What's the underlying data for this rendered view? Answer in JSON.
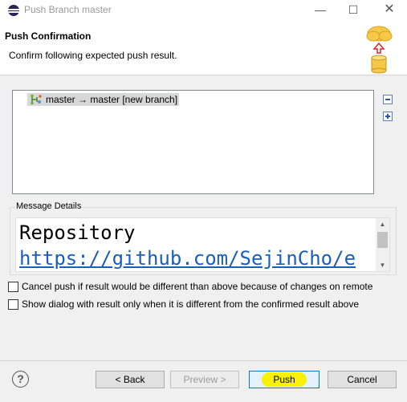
{
  "window": {
    "title": "Push Branch master",
    "minimize_glyph": "—",
    "maximize_glyph": "☐",
    "close_glyph": "✕"
  },
  "header": {
    "title": "Push Confirmation",
    "subtitle": "Confirm following expected push result.",
    "banner_icon": "cloud-push-to-database-icon"
  },
  "results": {
    "rows": [
      {
        "icon": "branch-update-icon",
        "label": "master → master [new branch]"
      }
    ],
    "collapse_all_icon": "collapse-all-icon",
    "expand_all_icon": "expand-all-icon"
  },
  "message_details": {
    "legend": "Message Details",
    "line1": "Repository",
    "line2": "https://github.com/SejinCho/e"
  },
  "options": {
    "cancel_if_different": "Cancel push if result would be different than above because of changes on remote",
    "show_only_if_different": "Show dialog with result only when it is different from the confirmed result above"
  },
  "footer": {
    "help": "?",
    "back": "< Back",
    "preview": "Preview >",
    "push": "Push",
    "cancel": "Cancel"
  },
  "colors": {
    "push_highlight": "#f8f200",
    "link": "#1a5fb4",
    "default_button_border": "#0078d7"
  }
}
